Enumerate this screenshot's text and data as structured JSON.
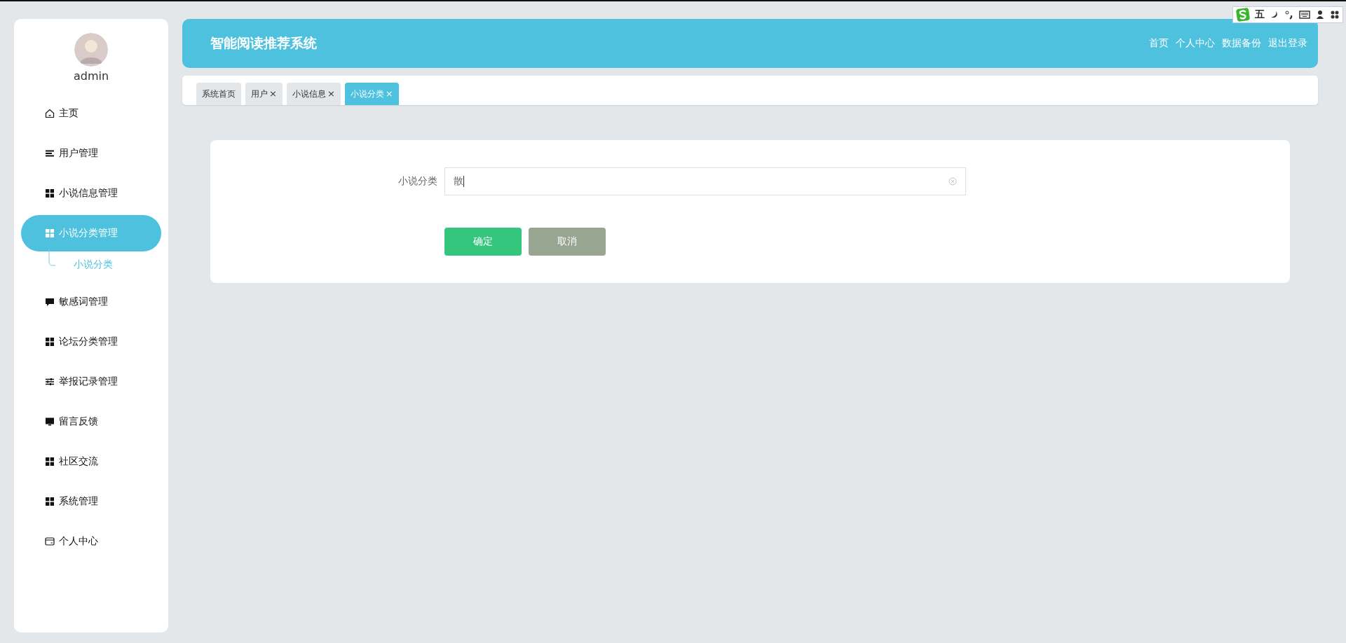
{
  "sidebar": {
    "user": "admin",
    "items": [
      {
        "label": "主页",
        "selected": false
      },
      {
        "label": "用户管理",
        "selected": false
      },
      {
        "label": "小说信息管理",
        "selected": false
      },
      {
        "label": "小说分类管理",
        "selected": true,
        "expanded": true,
        "children": [
          {
            "label": "小说分类",
            "selected": true
          }
        ]
      },
      {
        "label": "敏感词管理",
        "selected": false
      },
      {
        "label": "论坛分类管理",
        "selected": false
      },
      {
        "label": "举报记录管理",
        "selected": false
      },
      {
        "label": "留言反馈",
        "selected": false
      },
      {
        "label": "社区交流",
        "selected": false
      },
      {
        "label": "系统管理",
        "selected": false
      },
      {
        "label": "个人中心",
        "selected": false
      }
    ]
  },
  "header": {
    "title": "智能阅读推荐系统",
    "links": [
      "首页",
      "个人中心",
      "数据备份",
      "退出登录"
    ]
  },
  "tabs": [
    {
      "label": "系统首页",
      "closable": false,
      "selected": false
    },
    {
      "label": "用户",
      "closable": true,
      "selected": false
    },
    {
      "label": "小说信息",
      "closable": true,
      "selected": false
    },
    {
      "label": "小说分类",
      "closable": true,
      "selected": true
    }
  ],
  "close_glyph": "×",
  "form": {
    "fields": [
      {
        "label": "小说分类",
        "value": "散"
      }
    ],
    "buttons": [
      {
        "label": "确定",
        "kind": "primary"
      },
      {
        "label": "取消",
        "kind": "secondary"
      }
    ]
  },
  "ime_bar": {
    "mode": "五"
  }
}
